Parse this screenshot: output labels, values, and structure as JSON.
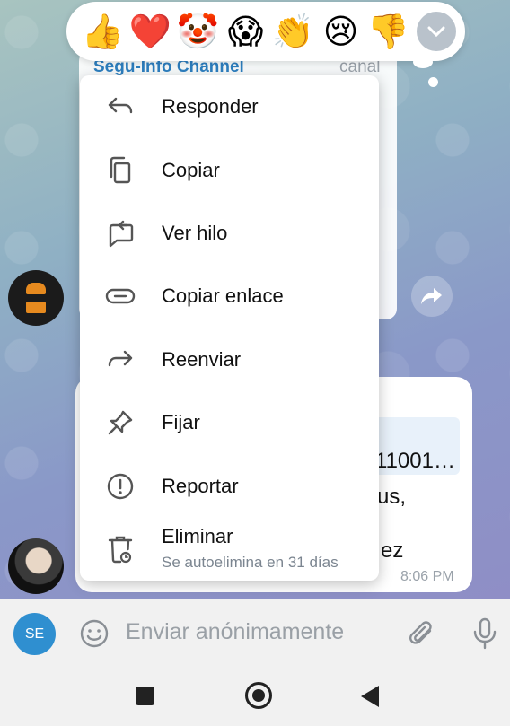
{
  "colors": {
    "accent": "#2f8fd0",
    "channel_name": "#2d7fc0",
    "menu_background": "#ffffff",
    "input_bar": "#f1f1f1"
  },
  "reactions": {
    "items": [
      {
        "name": "thumbs-up",
        "glyph": "👍"
      },
      {
        "name": "red-heart",
        "glyph": "❤️"
      },
      {
        "name": "clown-face",
        "glyph": "🤡"
      },
      {
        "name": "screaming-face",
        "glyph": "😱"
      },
      {
        "name": "clapping-hands",
        "glyph": "👏"
      },
      {
        "name": "crying-face",
        "glyph": "😢"
      },
      {
        "name": "thumbs-down",
        "glyph": "👎"
      }
    ],
    "more_icon": "chevron-down-icon"
  },
  "background_chat": {
    "channel_name": "Segu-Info Channel",
    "channel_tag": "canal",
    "link_snippet": "11001…",
    "text_snippet_1": "us,",
    "text_snippet_2": "ez",
    "time": "8:06 PM"
  },
  "menu": {
    "items": [
      {
        "label": "Responder",
        "icon": "reply-icon"
      },
      {
        "label": "Copiar",
        "icon": "copy-icon"
      },
      {
        "label": "Ver hilo",
        "icon": "thread-icon"
      },
      {
        "label": "Copiar enlace",
        "icon": "link-icon"
      },
      {
        "label": "Reenviar",
        "icon": "forward-icon"
      },
      {
        "label": "Fijar",
        "icon": "pin-icon"
      },
      {
        "label": "Reportar",
        "icon": "report-icon"
      },
      {
        "label": "Eliminar",
        "icon": "delete-icon",
        "sublabel": "Se autoelimina en 31 días"
      }
    ]
  },
  "input_bar": {
    "avatar_initials": "SE",
    "placeholder": "Enviar anónimamente"
  }
}
